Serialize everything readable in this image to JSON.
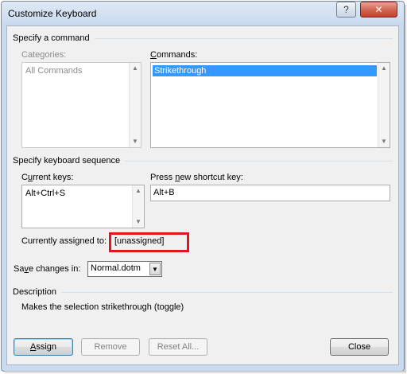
{
  "window": {
    "title": "Customize Keyboard",
    "help_glyph": "?",
    "close_glyph": "✕"
  },
  "command_section": {
    "heading": "Specify a command",
    "categories_label": "Categories:",
    "categories_items": [
      "All Commands"
    ],
    "commands_label": "Commands:",
    "commands_items": [
      "Strikethrough"
    ]
  },
  "keyboard_section": {
    "heading": "Specify keyboard sequence",
    "current_keys_label": "Current keys:",
    "current_keys_items": [
      "Alt+Ctrl+S"
    ],
    "new_shortcut_label": "Press new shortcut key:",
    "new_shortcut_value": "Alt+B"
  },
  "assignment": {
    "label": "Currently assigned to:",
    "value": "[unassigned]"
  },
  "save": {
    "label": "Save changes in:",
    "selected": "Normal.dotm"
  },
  "description": {
    "heading": "Description",
    "text": "Makes the selection strikethrough (toggle)"
  },
  "buttons": {
    "assign": "Assign",
    "remove": "Remove",
    "reset_all": "Reset All...",
    "close": "Close"
  },
  "colors": {
    "highlight": "#e0161f",
    "selection": "#3399ff"
  }
}
